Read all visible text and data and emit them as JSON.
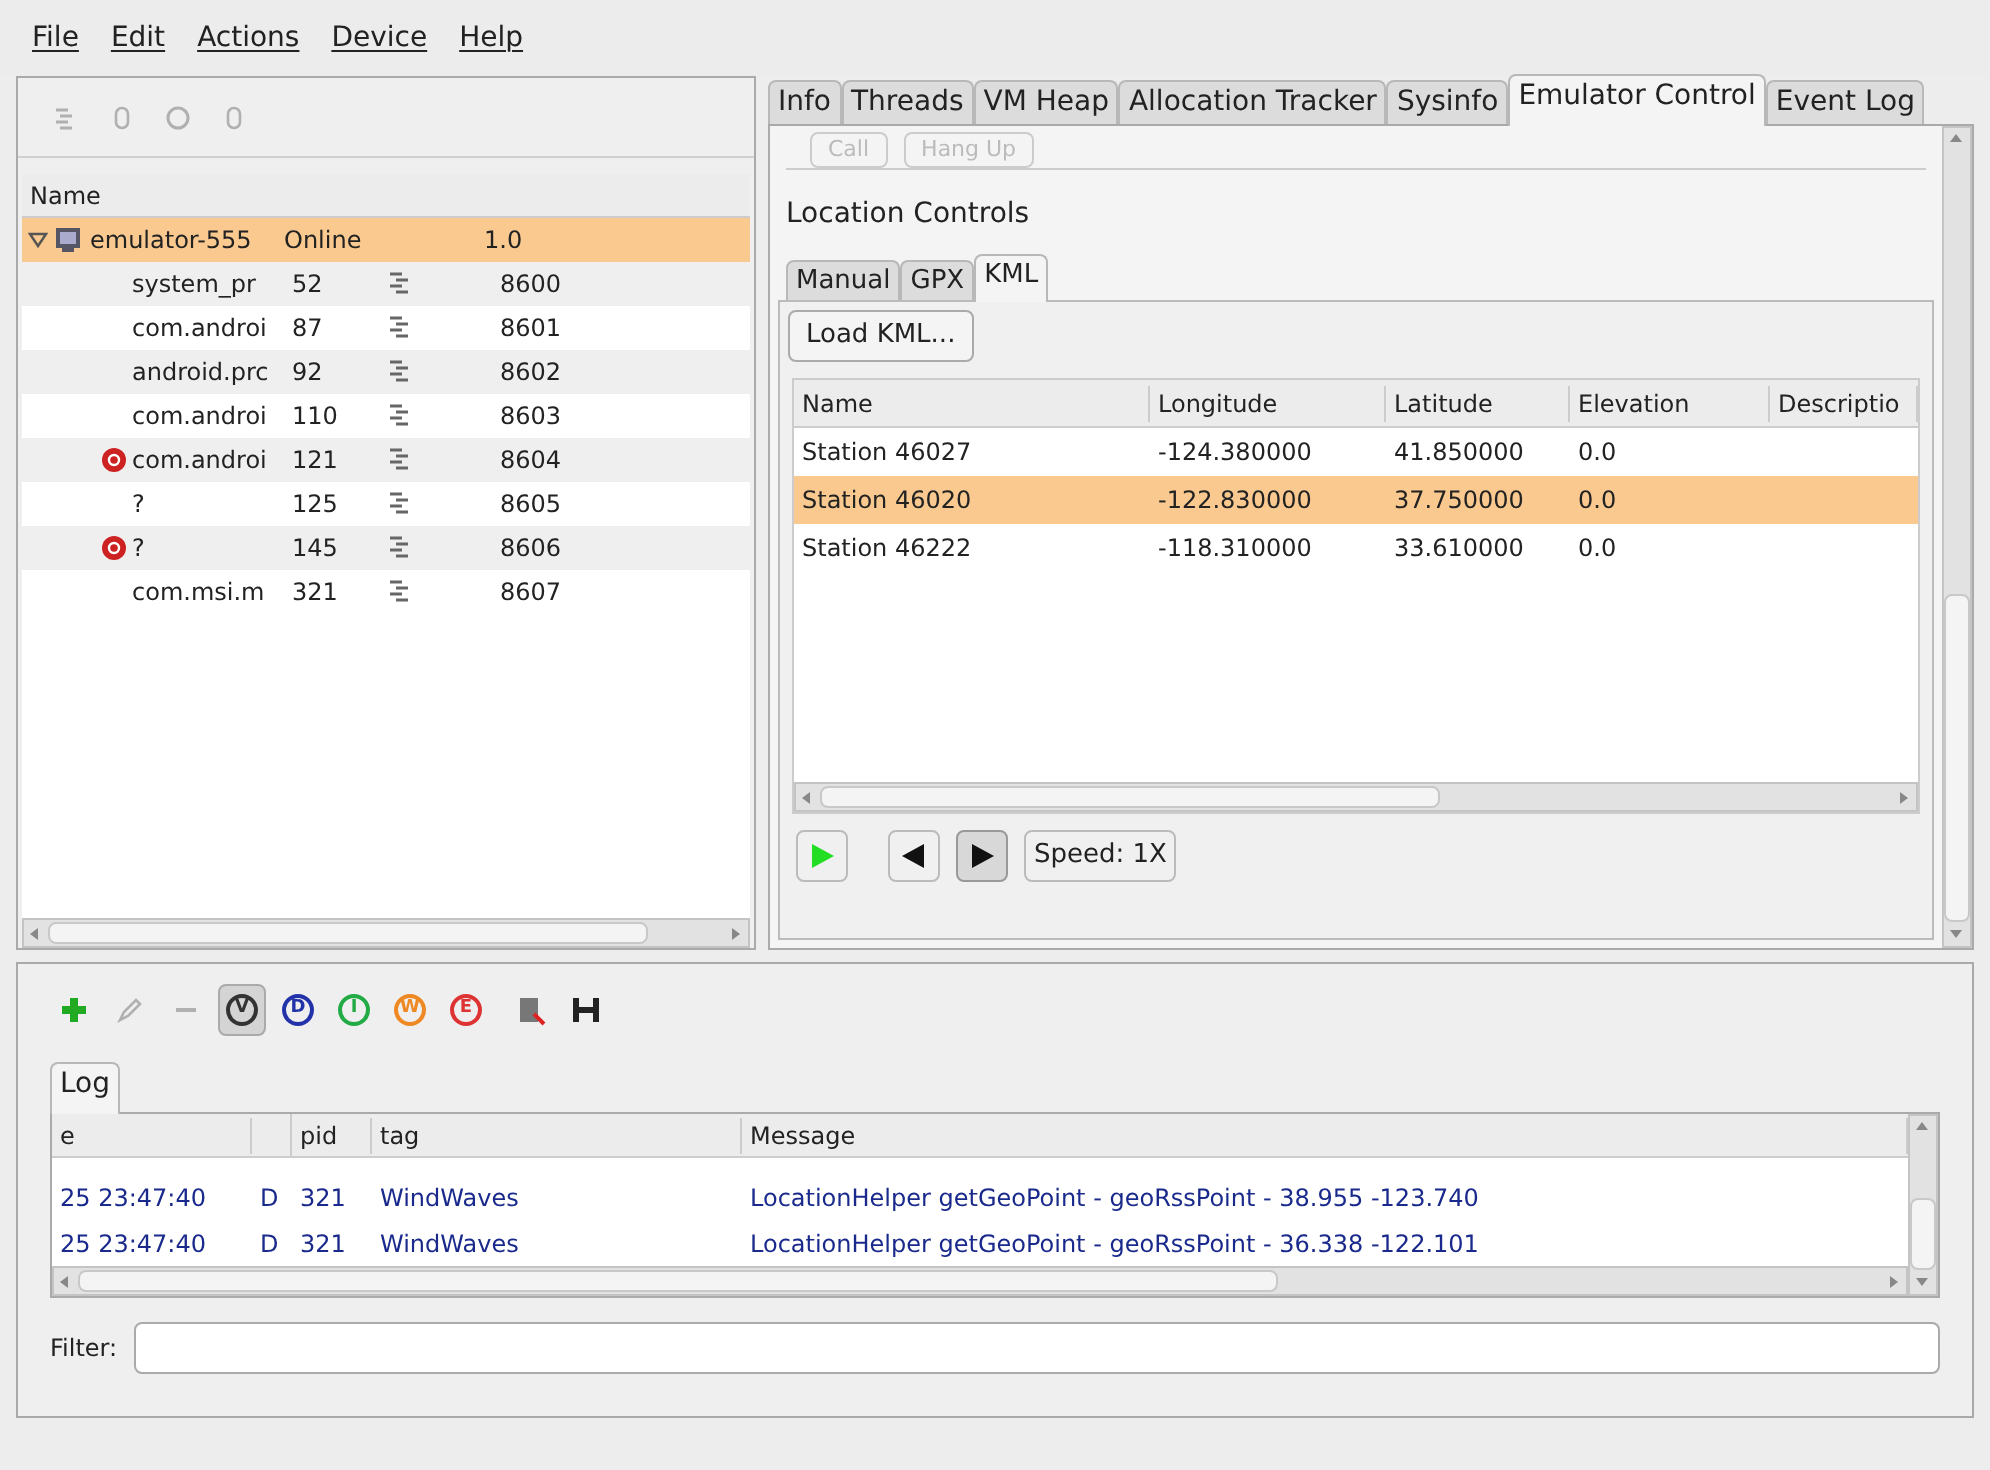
{
  "menu": [
    "File",
    "Edit",
    "Actions",
    "Device",
    "Help"
  ],
  "device_toolbar": [
    {
      "kind": "update",
      "disabled": true
    },
    {
      "kind": "heap",
      "disabled": true
    },
    {
      "kind": "stop",
      "disabled": true
    },
    {
      "kind": "dump",
      "disabled": true
    }
  ],
  "devices": {
    "columns": [
      "Name"
    ],
    "device": {
      "name": "emulator-555",
      "status": "Online",
      "version": "1.0",
      "expanded": true,
      "selected": true
    },
    "processes": [
      {
        "name": "system_pr",
        "pid": "52",
        "port": "8600",
        "debugger": false
      },
      {
        "name": "com.androi",
        "pid": "87",
        "port": "8601",
        "debugger": false
      },
      {
        "name": "android.prc",
        "pid": "92",
        "port": "8602",
        "debugger": false
      },
      {
        "name": "com.androi",
        "pid": "110",
        "port": "8603",
        "debugger": false
      },
      {
        "name": "com.androi",
        "pid": "121",
        "port": "8604",
        "debugger": true
      },
      {
        "name": "?",
        "pid": "125",
        "port": "8605",
        "debugger": false
      },
      {
        "name": "?",
        "pid": "145",
        "port": "8606",
        "debugger": true
      },
      {
        "name": "com.msi.m",
        "pid": "321",
        "port": "8607",
        "debugger": false
      }
    ]
  },
  "tabs": [
    {
      "label": "Info",
      "selected": false
    },
    {
      "label": "Threads",
      "selected": false
    },
    {
      "label": "VM Heap",
      "selected": false
    },
    {
      "label": "Allocation Tracker",
      "selected": false
    },
    {
      "label": "Sysinfo",
      "selected": false
    },
    {
      "label": "Emulator Control",
      "selected": true
    },
    {
      "label": "Event Log",
      "selected": false
    }
  ],
  "telephony_buttons": [
    {
      "label": "Call",
      "disabled": true
    },
    {
      "label": "Hang Up",
      "disabled": true
    }
  ],
  "location_controls": {
    "title": "Location Controls",
    "tabs": [
      {
        "label": "Manual",
        "selected": false
      },
      {
        "label": "GPX",
        "selected": false
      },
      {
        "label": "KML",
        "selected": true
      }
    ],
    "load_button": "Load KML...",
    "columns": [
      "Name",
      "Longitude",
      "Latitude",
      "Elevation",
      "Descriptio"
    ],
    "rows": [
      {
        "cells": [
          "Station 46027",
          "-124.380000",
          "41.850000",
          "0.0",
          ""
        ],
        "selected": false
      },
      {
        "cells": [
          "Station 46020",
          "-122.830000",
          "37.750000",
          "0.0",
          ""
        ],
        "selected": true
      },
      {
        "cells": [
          "Station 46222",
          "-118.310000",
          "33.610000",
          "0.0",
          ""
        ],
        "selected": false
      }
    ],
    "speed_button": "Speed: 1X"
  },
  "log_toolbar": [
    {
      "kind": "add",
      "disabled": false
    },
    {
      "kind": "edit",
      "disabled": true
    },
    {
      "kind": "remove",
      "disabled": true
    }
  ],
  "log_levels": [
    {
      "letter": "V",
      "color": "#333333",
      "selected": true
    },
    {
      "letter": "D",
      "color": "#2233aa",
      "selected": false
    },
    {
      "letter": "I",
      "color": "#22aa44",
      "selected": false
    },
    {
      "letter": "W",
      "color": "#ee8822",
      "selected": false
    },
    {
      "letter": "E",
      "color": "#dd3333",
      "selected": false
    }
  ],
  "log": {
    "tab": {
      "label": "Log",
      "selected": true
    },
    "columns": [
      "e",
      "",
      "pid",
      "tag",
      "Message"
    ],
    "rows": [
      [
        "25 23:47:40",
        "D",
        "321",
        "WindWaves",
        "LocationHelper getGeoPoint - geoRssPoint - 38.955 -123.740"
      ],
      [
        "25 23:47:40",
        "D",
        "321",
        "WindWaves",
        "LocationHelper getGeoPoint - geoRssPoint - 36.338 -122.101"
      ]
    ]
  },
  "filter": {
    "label": "Filter:"
  }
}
